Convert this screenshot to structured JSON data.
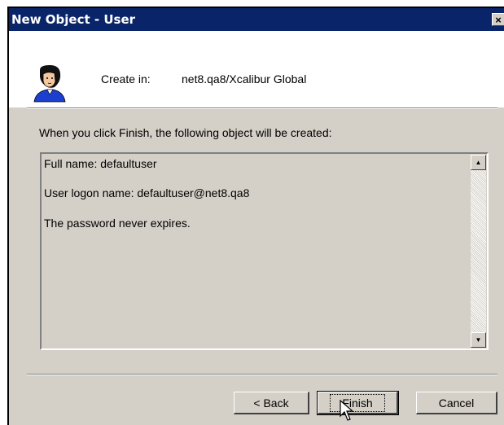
{
  "window": {
    "title": "New Object - User",
    "close_label": "×"
  },
  "header": {
    "icon": "user-icon",
    "create_in_label": "Create in:",
    "create_in_value": "net8.qa8/Xcalibur Global"
  },
  "intro_text": "When you click Finish, the following object will be created:",
  "summary": {
    "lines": [
      "Full name: defaultuser",
      "User logon name: defaultuser@net8.qa8",
      "The password never expires."
    ]
  },
  "buttons": {
    "back": "< Back",
    "finish": "Finish",
    "cancel": "Cancel"
  },
  "colors": {
    "titlebar": "#0a246a",
    "dialog_bg": "#d4d0c8",
    "header_bg": "#ffffff"
  }
}
